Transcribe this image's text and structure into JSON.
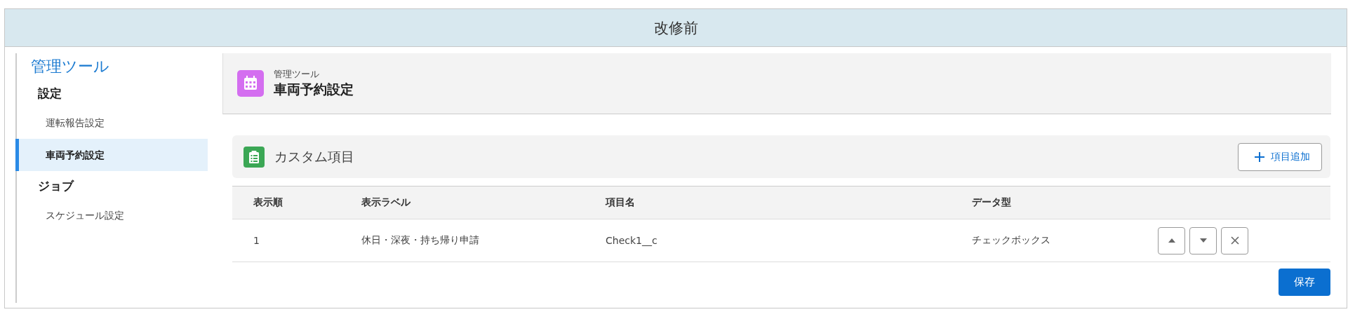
{
  "banner": {
    "title": "改修前"
  },
  "sidebar": {
    "title": "管理ツール",
    "groups": [
      {
        "heading": "設定",
        "items": [
          {
            "label": "運転報告設定",
            "selected": false
          },
          {
            "label": "車両予約設定",
            "selected": true
          }
        ]
      },
      {
        "heading": "ジョブ",
        "items": [
          {
            "label": "スケジュール設定",
            "selected": false
          }
        ]
      }
    ]
  },
  "page_header": {
    "breadcrumb": "管理ツール",
    "title": "車両予約設定"
  },
  "card": {
    "title": "カスタム項目",
    "add_button": "項目追加"
  },
  "table": {
    "columns": [
      "表示順",
      "表示ラベル",
      "項目名",
      "データ型"
    ],
    "rows": [
      {
        "cells": [
          "1",
          "休日・深夜・持ち帰り申請",
          "Check1__c",
          "チェックボックス"
        ]
      }
    ]
  },
  "save_button": "保存"
}
